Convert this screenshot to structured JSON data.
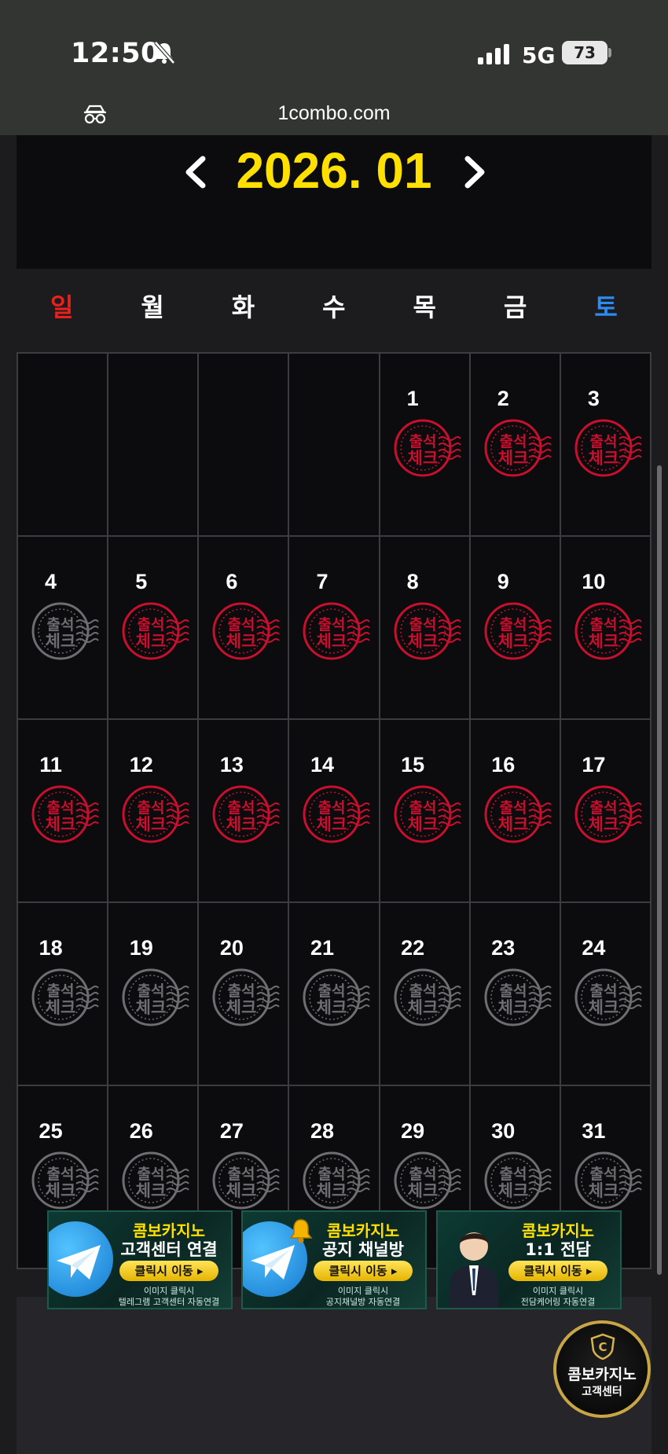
{
  "status_bar": {
    "time": "12:50",
    "network": "5G",
    "battery": "73"
  },
  "browser": {
    "url": "1combo.com"
  },
  "calendar": {
    "month_label": "2026. 01",
    "weekdays": [
      "일",
      "월",
      "화",
      "수",
      "목",
      "금",
      "토"
    ],
    "leading_blanks": 4,
    "days": [
      {
        "day": "1",
        "checked": true
      },
      {
        "day": "2",
        "checked": true
      },
      {
        "day": "3",
        "checked": true
      },
      {
        "day": "4",
        "checked": false
      },
      {
        "day": "5",
        "checked": true
      },
      {
        "day": "6",
        "checked": true
      },
      {
        "day": "7",
        "checked": true
      },
      {
        "day": "8",
        "checked": true
      },
      {
        "day": "9",
        "checked": true
      },
      {
        "day": "10",
        "checked": true
      },
      {
        "day": "11",
        "checked": true
      },
      {
        "day": "12",
        "checked": true
      },
      {
        "day": "13",
        "checked": true
      },
      {
        "day": "14",
        "checked": true
      },
      {
        "day": "15",
        "checked": true
      },
      {
        "day": "16",
        "checked": true
      },
      {
        "day": "17",
        "checked": true
      },
      {
        "day": "18",
        "checked": false
      },
      {
        "day": "19",
        "checked": false
      },
      {
        "day": "20",
        "checked": false
      },
      {
        "day": "21",
        "checked": false
      },
      {
        "day": "22",
        "checked": false
      },
      {
        "day": "23",
        "checked": false
      },
      {
        "day": "24",
        "checked": false
      },
      {
        "day": "25",
        "checked": false
      },
      {
        "day": "26",
        "checked": false
      },
      {
        "day": "27",
        "checked": false
      },
      {
        "day": "28",
        "checked": false
      },
      {
        "day": "29",
        "checked": false
      },
      {
        "day": "30",
        "checked": false
      },
      {
        "day": "31",
        "checked": false
      }
    ],
    "stamp_text_top": "출석",
    "stamp_text_bottom": "체크",
    "colors": {
      "stamp_checked": "#c8102e",
      "stamp_unchecked": "#6e6e72",
      "month": "#ffe000",
      "sunday": "#e8211d",
      "saturday": "#2d8cf0"
    }
  },
  "banners": [
    {
      "title1": "콤보카지노",
      "title2": "고객센터 연결",
      "button": "클릭시 이동 ▸",
      "note1": "이미지 클릭시",
      "note2": "텔레그램 고객센터 자동연결",
      "icon": "telegram-icon"
    },
    {
      "title1": "콤보카지노",
      "title2": "공지 채널방",
      "button": "클릭시 이동 ▸",
      "note1": "이미지 클릭시",
      "note2": "공지채널방 자동연결",
      "icon": "bell-icon"
    },
    {
      "title1": "콤보카지노",
      "title2": "1:1 전담",
      "button": "클릭시 이동 ▸",
      "note1": "이미지 클릭시",
      "note2": "전담케어링 자동연결",
      "icon": "agent-avatar"
    }
  ],
  "fab": {
    "title": "콤보카지노",
    "subtitle": "고객센터"
  }
}
